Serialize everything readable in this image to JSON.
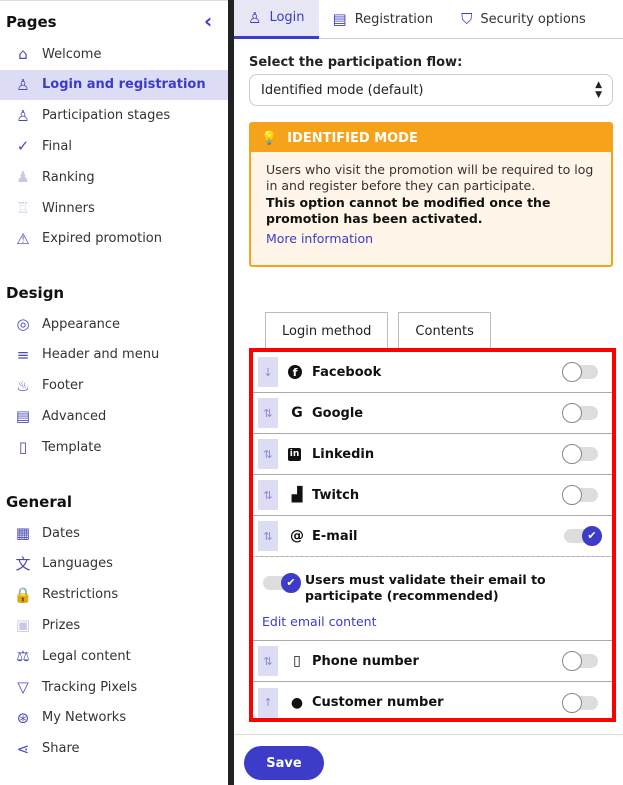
{
  "sidebar": {
    "sections": [
      {
        "title": "Pages",
        "items": [
          {
            "label": "Welcome",
            "icon": "home-icon",
            "glyph": "⌂"
          },
          {
            "label": "Login and registration",
            "icon": "user-login-icon",
            "glyph": "♙",
            "active": true
          },
          {
            "label": "Participation stages",
            "icon": "user-stages-icon",
            "glyph": "♙"
          },
          {
            "label": "Final",
            "icon": "check-icon",
            "glyph": "✓"
          },
          {
            "label": "Ranking",
            "icon": "ranking-icon",
            "glyph": "♟",
            "faded": true
          },
          {
            "label": "Winners",
            "icon": "trophy-icon",
            "glyph": "♖",
            "faded": true
          },
          {
            "label": "Expired promotion",
            "icon": "warning-icon",
            "glyph": "⚠"
          }
        ]
      },
      {
        "title": "Design",
        "items": [
          {
            "label": "Appearance",
            "icon": "palette-icon",
            "glyph": "◎"
          },
          {
            "label": "Header and menu",
            "icon": "menu-icon",
            "glyph": "≡"
          },
          {
            "label": "Footer",
            "icon": "footprint-icon",
            "glyph": "♨"
          },
          {
            "label": "Advanced",
            "icon": "document-icon",
            "glyph": "▤"
          },
          {
            "label": "Template",
            "icon": "file-icon",
            "glyph": "▯"
          }
        ]
      },
      {
        "title": "General",
        "items": [
          {
            "label": "Dates",
            "icon": "calendar-icon",
            "glyph": "▦"
          },
          {
            "label": "Languages",
            "icon": "translate-icon",
            "glyph": "文"
          },
          {
            "label": "Restrictions",
            "icon": "lock-icon",
            "glyph": "🔒",
            "faded": true
          },
          {
            "label": "Prizes",
            "icon": "gift-icon",
            "glyph": "▣",
            "faded": true
          },
          {
            "label": "Legal content",
            "icon": "gavel-icon",
            "glyph": "⚖"
          },
          {
            "label": "Tracking Pixels",
            "icon": "filter-icon",
            "glyph": "▽"
          },
          {
            "label": "My Networks",
            "icon": "network-icon",
            "glyph": "⊛"
          },
          {
            "label": "Share",
            "icon": "share-icon",
            "glyph": "⋖"
          }
        ]
      }
    ]
  },
  "tabs": [
    {
      "label": "Login",
      "icon": "user-icon",
      "glyph": "♙",
      "active": true
    },
    {
      "label": "Registration",
      "icon": "form-icon",
      "glyph": "▤"
    },
    {
      "label": "Security options",
      "icon": "shield-icon",
      "glyph": "⛉"
    }
  ],
  "flow": {
    "label": "Select the participation flow:",
    "value": "Identified mode (default)"
  },
  "alert": {
    "title": "IDENTIFIED MODE",
    "text": "Users who visit the promotion will be required to log in and register before they can participate.",
    "warning": "This option cannot be modified once the promotion has been activated.",
    "link": "More information",
    "color": "#f7a21b"
  },
  "content_tabs": [
    "Login method",
    "Contents"
  ],
  "methods": [
    {
      "label": "Facebook",
      "icon": "facebook-icon",
      "glyph": "f",
      "handle": "↓",
      "on": false
    },
    {
      "label": "Google",
      "icon": "google-icon",
      "glyph": "G",
      "handle": "⇅",
      "on": false
    },
    {
      "label": "Linkedin",
      "icon": "linkedin-icon",
      "glyph": "in",
      "handle": "⇅",
      "on": false
    },
    {
      "label": "Twitch",
      "icon": "twitch-icon",
      "glyph": "▟",
      "handle": "⇅",
      "on": false
    },
    {
      "label": "E-mail",
      "icon": "at-icon",
      "glyph": "@",
      "handle": "⇅",
      "on": true
    },
    {
      "label": "Phone number",
      "icon": "phone-icon",
      "glyph": "▯",
      "handle": "⇅",
      "on": false
    },
    {
      "label": "Customer number",
      "icon": "person-icon",
      "glyph": "●",
      "handle": "↑",
      "on": false
    }
  ],
  "email_options": {
    "validate_label": "Users must validate their email to participate (recommended)",
    "validate_on": true,
    "edit_link": "Edit email content"
  },
  "save_label": "Save",
  "accent": "#3c3cc8"
}
